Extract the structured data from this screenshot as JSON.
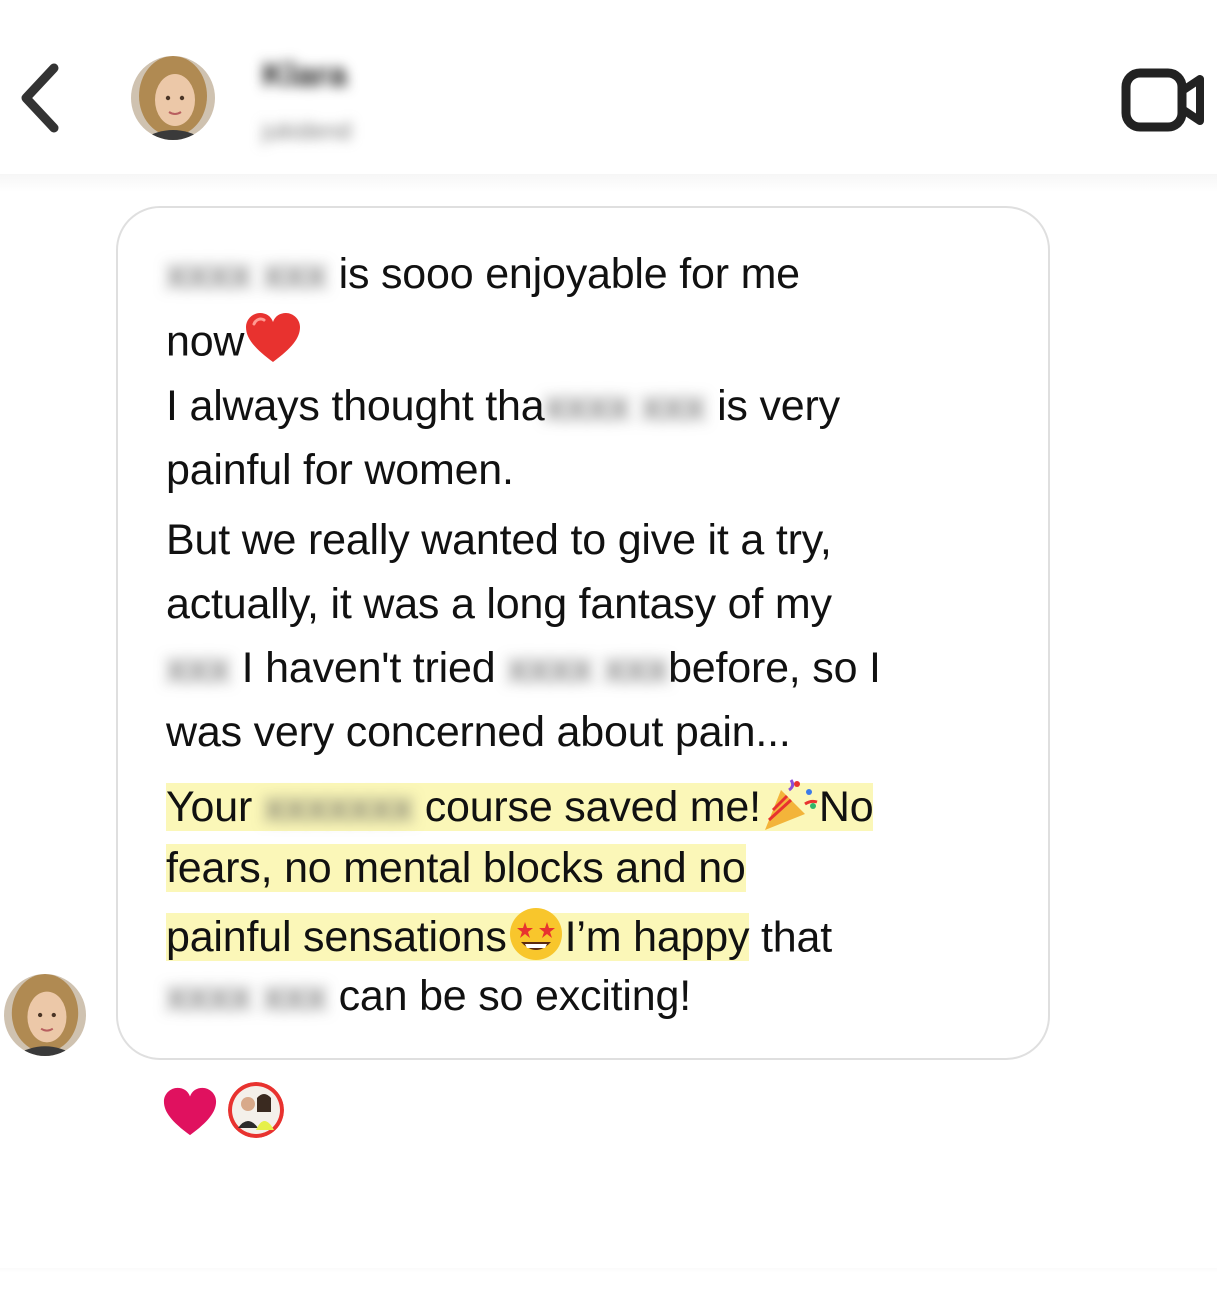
{
  "header": {
    "contact_name": "Klara",
    "contact_username": "jukidend"
  },
  "message": {
    "line1_blur": "xxxx xxx",
    "line1_text": " is sooo enjoyable for me",
    "line2_text": "now",
    "line3_text_a": "I always thought tha",
    "line3_blur": "xxxx xxx",
    "line3_text_b": " is very",
    "line4_text": "painful for women.",
    "line5_text": "But we really wanted to give it a try,",
    "line6_text": "actually, it was a long fantasy of my",
    "line7_blur_a": "xxx",
    "line7_text_a": " I haven't tried",
    "line7_blur_b": "xxxx xxx",
    "line7_text_b": "before, so I",
    "line8_text": "was very concerned about pain...",
    "line9_text_a": "Your ",
    "line9_blur": "xxxxxxx",
    "line9_text_b": " course saved me!",
    "line9_text_c": "No",
    "line10_text": "fears, no mental blocks and no",
    "line11_text_hl": "painful sensations",
    "line11_text_hl2": "I’m happy",
    "line11_text_b": " that",
    "line12_blur": "xxxx xxx",
    "line12_text": " can be so exciting!"
  },
  "icons": {
    "back": "chevron-left-icon",
    "video": "video-camera-icon",
    "heart_emoji": "red-heart-emoji",
    "party_emoji": "party-popper-emoji",
    "star_eyes_emoji": "star-struck-emoji",
    "reaction": "heart-reaction-icon"
  },
  "colors": {
    "highlight": "#fbf7b8",
    "reaction_heart": "#e0115f",
    "bubble_border": "#dfdfdf"
  }
}
